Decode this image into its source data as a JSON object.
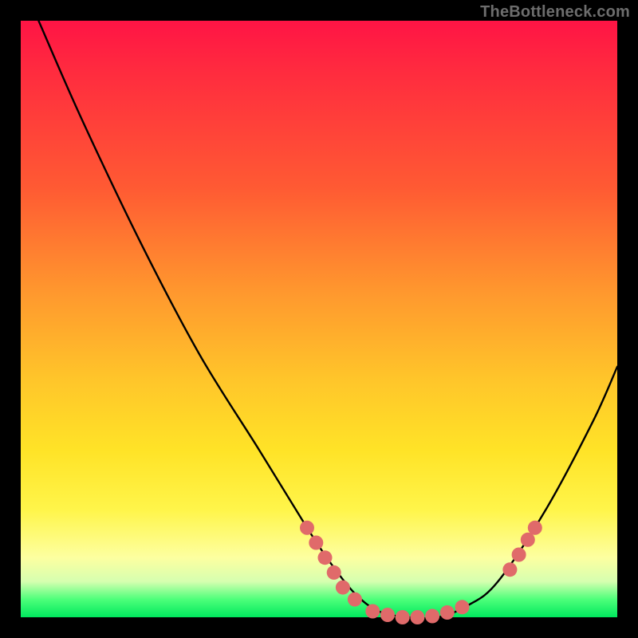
{
  "watermark": "TheBottleneck.com",
  "colors": {
    "background": "#000000",
    "curve": "#000000",
    "marker": "#e06a6a",
    "gradient_stops": [
      "#ff1445",
      "#ff2a3f",
      "#ff5a33",
      "#ff962e",
      "#ffc52a",
      "#ffe327",
      "#fff54a",
      "#fdffa0",
      "#d6ffb0",
      "#4dff7a",
      "#00e85e"
    ]
  },
  "chart_data": {
    "type": "line",
    "title": "",
    "xlabel": "",
    "ylabel": "",
    "xlim": [
      0,
      100
    ],
    "ylim": [
      0,
      100
    ],
    "grid": false,
    "legend": false,
    "series": [
      {
        "name": "bottleneck-curve",
        "x": [
          3,
          10,
          20,
          30,
          40,
          48,
          52,
          56,
          60,
          65,
          70,
          75,
          80,
          88,
          96,
          100
        ],
        "y": [
          100,
          84,
          63,
          44,
          28,
          15,
          9,
          4,
          1,
          0,
          0,
          2,
          6,
          18,
          33,
          42
        ]
      }
    ],
    "markers": [
      {
        "name": "left-cluster",
        "points": [
          {
            "x": 48,
            "y": 15
          },
          {
            "x": 49.5,
            "y": 12.5
          },
          {
            "x": 51,
            "y": 10
          },
          {
            "x": 52.5,
            "y": 7.5
          },
          {
            "x": 54,
            "y": 5
          },
          {
            "x": 56,
            "y": 3
          }
        ]
      },
      {
        "name": "bottom-cluster",
        "points": [
          {
            "x": 59,
            "y": 1
          },
          {
            "x": 61.5,
            "y": 0.4
          },
          {
            "x": 64,
            "y": 0
          },
          {
            "x": 66.5,
            "y": 0
          },
          {
            "x": 69,
            "y": 0.2
          },
          {
            "x": 71.5,
            "y": 0.8
          },
          {
            "x": 74,
            "y": 1.7
          }
        ]
      },
      {
        "name": "right-cluster",
        "points": [
          {
            "x": 82,
            "y": 8
          },
          {
            "x": 83.5,
            "y": 10.5
          },
          {
            "x": 85,
            "y": 13
          },
          {
            "x": 86.2,
            "y": 15
          }
        ]
      }
    ]
  }
}
